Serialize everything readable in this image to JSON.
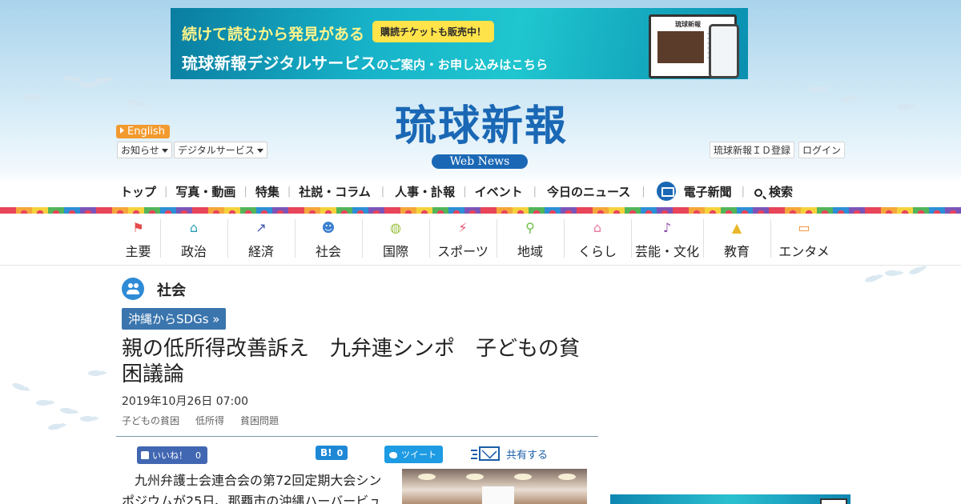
{
  "banner": {
    "line1": "続けて読むから発見がある",
    "badge": "購読チケットも販売中！",
    "line2_a": "琉球新報デジタルサービス",
    "line2_b": "のご案内・お申し込み",
    "line2_c": "はこちら",
    "device_logo": "琉球新報"
  },
  "header": {
    "english": "English",
    "notice": "お知らせ",
    "digital": "デジタルサービス",
    "logo": "琉球新報",
    "logo_sub": "Web News",
    "register": "琉球新報ＩＤ登録",
    "login": "ログイン"
  },
  "gnav": [
    "トップ",
    "写真・動画",
    "特集",
    "社説・コラム",
    "人事・訃報",
    "イベント",
    "今日のニュース",
    "電子新聞",
    "検索"
  ],
  "categories": [
    {
      "label": "主要",
      "icon": "flag-icon",
      "color": "#e54b4b"
    },
    {
      "label": "政治",
      "icon": "building-icon",
      "color": "#2a9fb5"
    },
    {
      "label": "経済",
      "icon": "chart-icon",
      "color": "#3a55a8"
    },
    {
      "label": "社会",
      "icon": "people-icon",
      "color": "#3a7fd0"
    },
    {
      "label": "国際",
      "icon": "globe-icon",
      "color": "#9bc03a"
    },
    {
      "label": "スポーツ",
      "icon": "runner-icon",
      "color": "#e54b6a"
    },
    {
      "label": "地域",
      "icon": "pin-icon",
      "color": "#6bbf4a"
    },
    {
      "label": "くらし",
      "icon": "house-icon",
      "color": "#e87aa0"
    },
    {
      "label": "芸能・文化",
      "icon": "sanshin-icon",
      "color": "#8b4aa8"
    },
    {
      "label": "教育",
      "icon": "graduation-cap-icon",
      "color": "#e8b82a"
    },
    {
      "label": "エンタメ",
      "icon": "tv-icon",
      "color": "#f08a2a"
    }
  ],
  "article": {
    "section": "社会",
    "series": "沖縄からSDGs »",
    "title": "親の低所得改善訴え　九弁連シンポ　子どもの貧困議論",
    "date": "2019年10月26日 07:00",
    "tags": [
      "子どもの貧困",
      "低所得",
      "貧困問題"
    ],
    "body": "九州弁護士会連合会の第72回定期大会シンポジウムが25日、那覇市の沖縄ハーバービュ"
  },
  "social": {
    "like": "いいね！",
    "like_count": "0",
    "hatena": "B!",
    "hatena_count": "0",
    "tweet": "ツイート",
    "share": "共有する"
  }
}
